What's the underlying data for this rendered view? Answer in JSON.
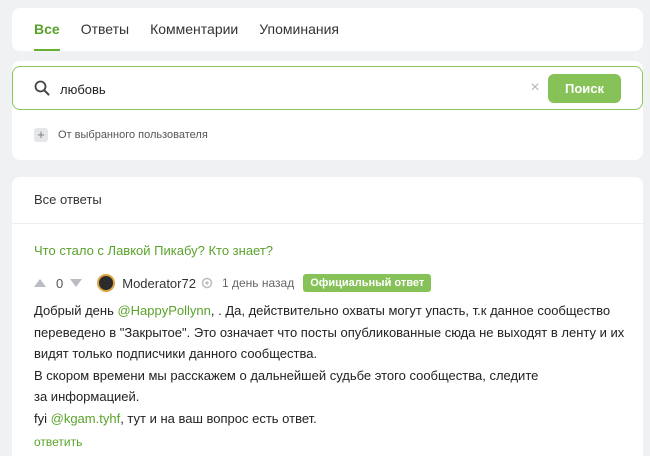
{
  "tabs": [
    {
      "label": "Все",
      "active": true
    },
    {
      "label": "Ответы",
      "active": false
    },
    {
      "label": "Комментарии",
      "active": false
    },
    {
      "label": "Упоминания",
      "active": false
    }
  ],
  "search": {
    "value": "любовь",
    "button_label": "Поиск",
    "clear_icon": "close-icon",
    "search_icon": "search-icon"
  },
  "user_filter": {
    "label": "От выбранного пользователя",
    "icon": "plus-icon"
  },
  "results": {
    "header": "Все ответы",
    "items": [
      {
        "post_title": "Что стало с Лавкой Пикабу? Кто знает?",
        "rating": "0",
        "author": "Moderator72",
        "time": "1 день назад",
        "badge": "Официальный ответ",
        "body": {
          "greeting": "Добрый день ",
          "mention1": "@HappyPollynn",
          "text1": ", . Да, действительно охваты могут упасть, т.к данное сообщество переведено в \"Закрытое\". Это означает что посты опубликованные сюда не выходят в ленту и их видят только подписчики данного сообщества.",
          "text2": "В скором времени мы расскажем о дальнейшей судьбе этого сообщества, следите",
          "text3": "за информацией.",
          "fyi": "fyi ",
          "mention2": "@kgam.tyhf",
          "text4": ", тут и на ваш вопрос есть ответ."
        },
        "reply_label": "ответить"
      }
    ]
  },
  "colors": {
    "accent": "#5aa22a",
    "button": "#86c258",
    "background": "#f0f1f3"
  }
}
